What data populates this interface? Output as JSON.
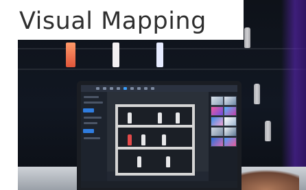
{
  "title": "Visual Mapping",
  "colors": {
    "accent": "#3aa0ff",
    "highlight_bottle": "#e44a4a",
    "purple_glow": "#6428c8"
  }
}
